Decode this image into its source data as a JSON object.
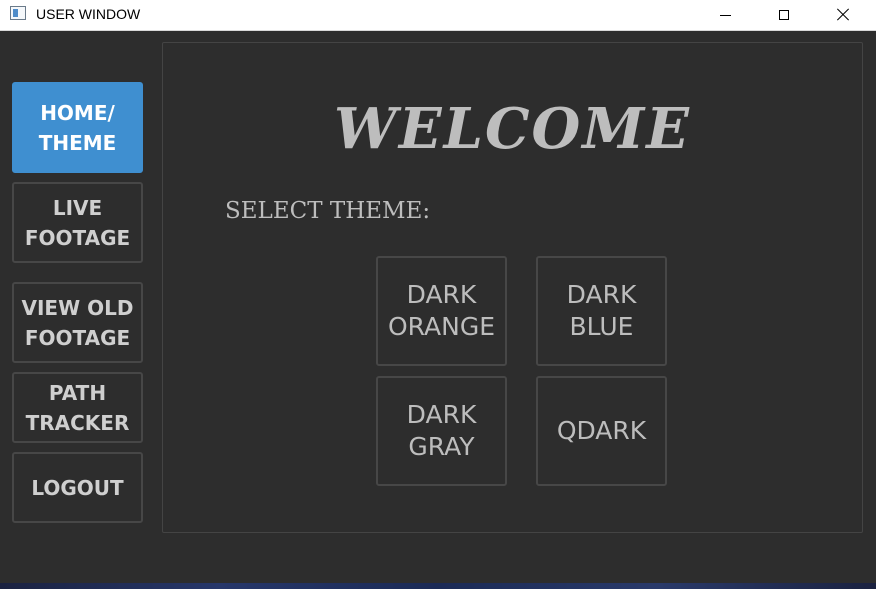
{
  "window": {
    "title": "USER WINDOW"
  },
  "sidebar": {
    "items": [
      {
        "label": "HOME/\nTHEME",
        "active": true
      },
      {
        "label": "LIVE\nFOOTAGE",
        "active": false
      },
      {
        "label": "VIEW OLD\nFOOTAGE",
        "active": false
      },
      {
        "label": "PATH\nTRACKER",
        "active": false
      },
      {
        "label": "LOGOUT",
        "active": false
      }
    ]
  },
  "main": {
    "heading": "WELCOME",
    "select_label": "SELECT THEME:",
    "themes": [
      {
        "label": "DARK\nORANGE"
      },
      {
        "label": "DARK\nBLUE"
      },
      {
        "label": "DARK\nGRAY"
      },
      {
        "label": "QDARK"
      }
    ]
  },
  "colors": {
    "accent": "#3f8fd0",
    "background": "#2d2d2d",
    "text": "#bdbdbd"
  }
}
